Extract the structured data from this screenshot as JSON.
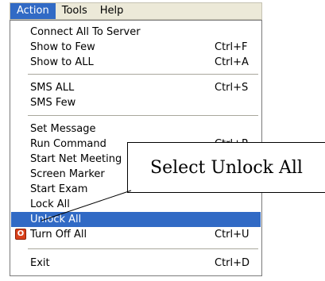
{
  "menubar": {
    "items": [
      {
        "label": "Action",
        "active": true
      },
      {
        "label": "Tools",
        "active": false
      },
      {
        "label": "Help",
        "active": false
      }
    ]
  },
  "menu": {
    "items": [
      {
        "label": "Connect All To Server",
        "shortcut": ""
      },
      {
        "label": "Show to Few",
        "shortcut": "Ctrl+F"
      },
      {
        "label": "Show to ALL",
        "shortcut": "Ctrl+A"
      },
      {
        "label": "SMS ALL",
        "shortcut": "Ctrl+S"
      },
      {
        "label": "SMS Few",
        "shortcut": ""
      },
      {
        "label": "Set Message",
        "shortcut": ""
      },
      {
        "label": "Run Command",
        "shortcut": "Ctrl+R"
      },
      {
        "label": "Start Net Meeting",
        "shortcut": ""
      },
      {
        "label": "Screen Marker",
        "shortcut": ""
      },
      {
        "label": "Start Exam",
        "shortcut": ""
      },
      {
        "label": "Lock All",
        "shortcut": ""
      },
      {
        "label": "Unlock  All",
        "shortcut": "",
        "highlighted": true
      },
      {
        "label": "Turn Off All",
        "shortcut": "Ctrl+U",
        "icon": "power-icon"
      },
      {
        "label": "Exit",
        "shortcut": "Ctrl+D"
      }
    ]
  },
  "callout": {
    "text": "Select Unlock All"
  },
  "colors": {
    "highlight": "#316ac5",
    "menubar": "#ece9d8",
    "power_icon": "#d8401a"
  }
}
